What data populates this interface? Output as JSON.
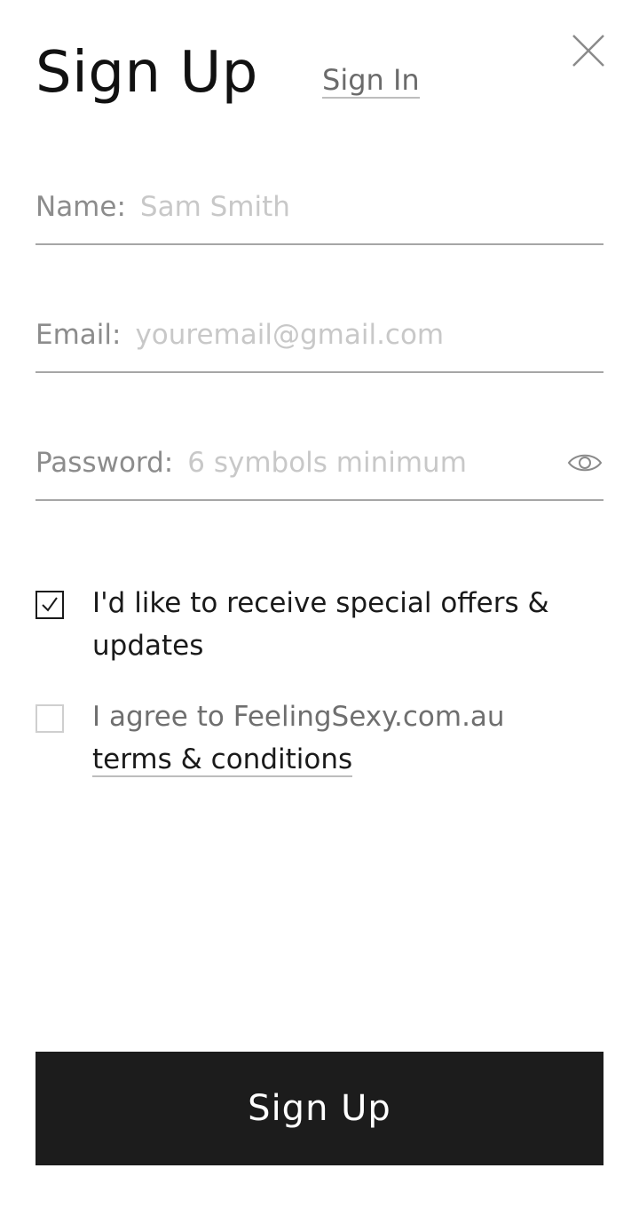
{
  "header": {
    "title": "Sign Up",
    "signin_link": "Sign In",
    "close_icon": "close-icon"
  },
  "form": {
    "name": {
      "label": "Name:",
      "placeholder": "Sam Smith",
      "value": ""
    },
    "email": {
      "label": "Email:",
      "placeholder": "youremail@gmail.com",
      "value": ""
    },
    "password": {
      "label": "Password:",
      "placeholder": "6 symbols minimum",
      "value": "",
      "toggle_icon": "eye-icon"
    }
  },
  "checkboxes": {
    "offers": {
      "label": "I'd like to receive special offers & updates",
      "checked": true
    },
    "terms": {
      "label_prefix": "I agree to FeelingSexy.com.au",
      "link_text": "terms & conditions",
      "checked": false
    }
  },
  "submit_label": "Sign Up",
  "colors": {
    "button_bg": "#1c1c1c",
    "button_text": "#ffffff",
    "field_border": "#a6a6a6",
    "label": "#8c8c8c",
    "placeholder": "#c8c8c8"
  }
}
